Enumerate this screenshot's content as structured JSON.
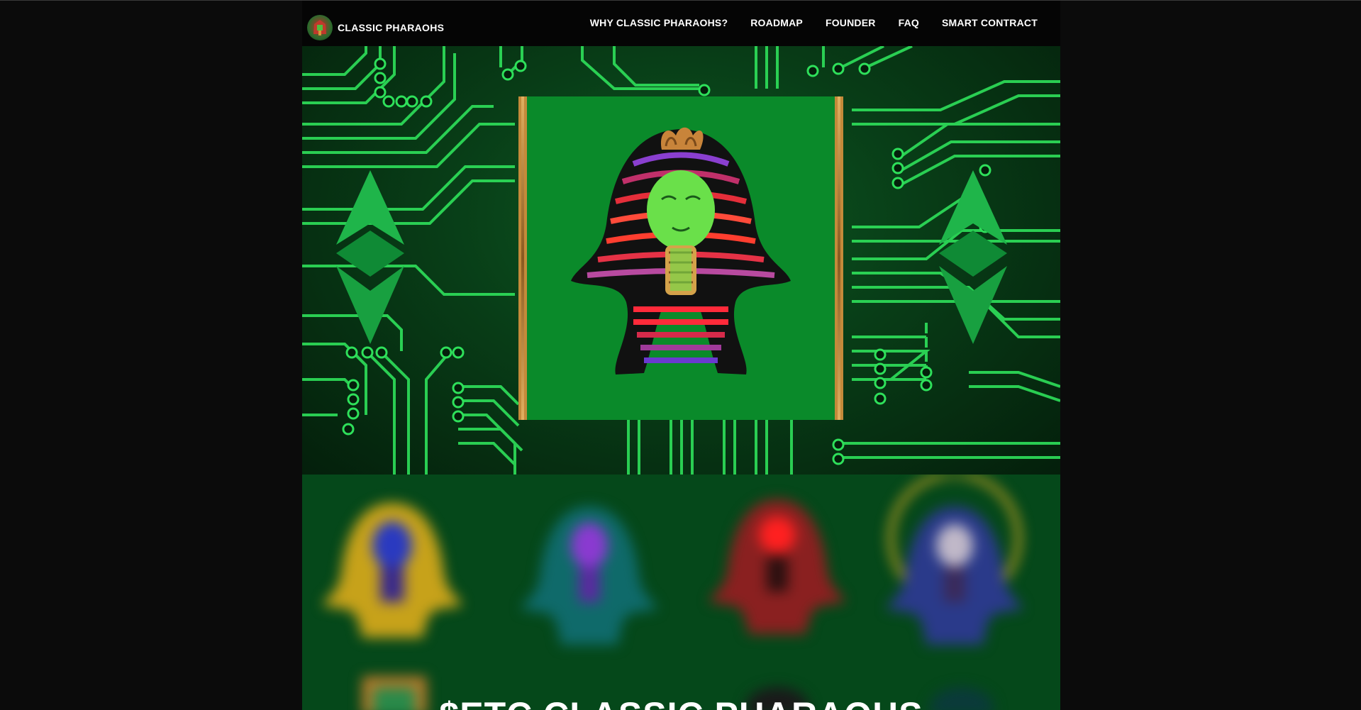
{
  "header": {
    "brand": "CLASSIC PHARAOHS",
    "nav": [
      {
        "label": "WHY CLASSIC PHARAOHS?"
      },
      {
        "label": "ROADMAP"
      },
      {
        "label": "FOUNDER"
      },
      {
        "label": "FAQ"
      },
      {
        "label": "SMART CONTRACT"
      }
    ]
  },
  "hero": {
    "art": "green-pharaoh-nft",
    "side_icons": [
      "etc-logo-icon",
      "etc-logo-icon"
    ]
  },
  "collection": {
    "headline": "$ETC CLASSIC PHARAOHS"
  },
  "colors": {
    "page_bg": "#0b0b0b",
    "header_bg": "#050505",
    "hero_green": "#0a8a2a",
    "circuit_green": "#2ee05a",
    "frame_gold": "#c48a3a",
    "collection_bg": "#05481a"
  }
}
